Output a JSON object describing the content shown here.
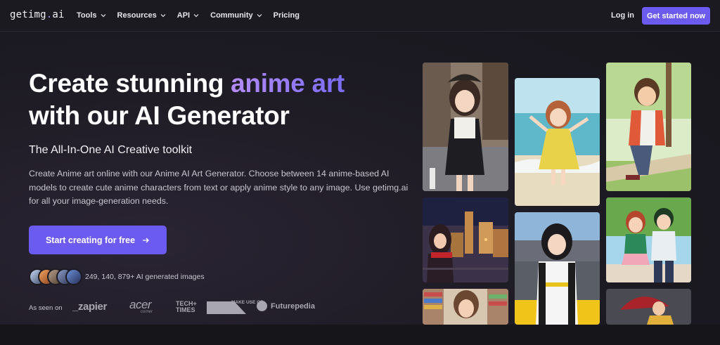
{
  "nav": {
    "logo_main": "getimg",
    "logo_dot": ".",
    "logo_tld": "ai",
    "items": [
      {
        "label": "Tools",
        "dropdown": true
      },
      {
        "label": "Resources",
        "dropdown": true
      },
      {
        "label": "API",
        "dropdown": true
      },
      {
        "label": "Community",
        "dropdown": true
      },
      {
        "label": "Pricing",
        "dropdown": false
      }
    ],
    "login": "Log in",
    "get_started": "Get started now"
  },
  "hero": {
    "title_part1": "Create stunning ",
    "title_highlight": "anime art",
    "title_part2": "with our AI Generator",
    "subtitle": "The All-In-One AI Creative toolkit",
    "description": "Create Anime art online with our Anime AI Art Generator. Choose between 14 anime-based AI models to create cute anime characters from text or apply anime style to any image. Use getimg.ai for all your image-generation needs.",
    "cta": "Start creating for free",
    "generated_count": "249, 140, 879+ AI generated images",
    "seen_on_label": "As seen on",
    "brands": {
      "zapier": "_zapier",
      "acer": "acer",
      "acer_sub": "corner",
      "techtimes": "TECH+ TIMES",
      "makeuseof": "MAKE USE OF.",
      "futurepedia": "Futurepedia"
    }
  },
  "colors": {
    "accent": "#6b5bf0",
    "background": "#1c1a22",
    "highlight_start": "#b48cf7",
    "highlight_end": "#7a6cf4"
  },
  "gallery": [
    "anime-girl-city-street",
    "anime-girl-beach-jump",
    "anime-boy-park-bench",
    "anime-girl-night-city-balcony",
    "anime-girl-racer",
    "anime-couple-walking",
    "anime-girl-library",
    "anime-umbrella-rain"
  ]
}
